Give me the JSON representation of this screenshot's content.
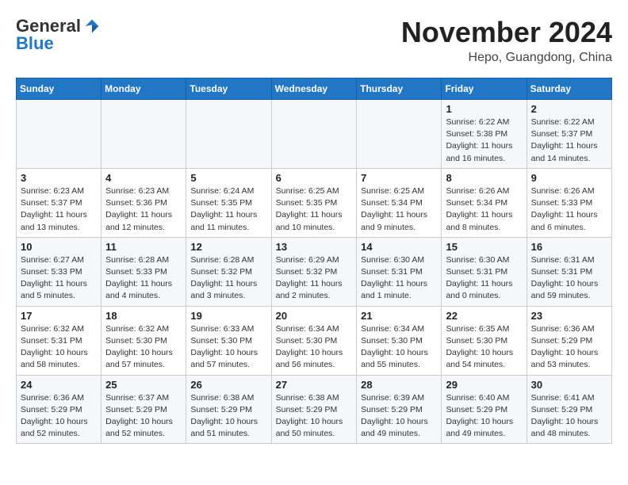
{
  "header": {
    "logo_general": "General",
    "logo_blue": "Blue",
    "month_title": "November 2024",
    "location": "Hepo, Guangdong, China"
  },
  "days_of_week": [
    "Sunday",
    "Monday",
    "Tuesday",
    "Wednesday",
    "Thursday",
    "Friday",
    "Saturday"
  ],
  "weeks": [
    [
      {
        "day": "",
        "info": ""
      },
      {
        "day": "",
        "info": ""
      },
      {
        "day": "",
        "info": ""
      },
      {
        "day": "",
        "info": ""
      },
      {
        "day": "",
        "info": ""
      },
      {
        "day": "1",
        "info": "Sunrise: 6:22 AM\nSunset: 5:38 PM\nDaylight: 11 hours and 16 minutes."
      },
      {
        "day": "2",
        "info": "Sunrise: 6:22 AM\nSunset: 5:37 PM\nDaylight: 11 hours and 14 minutes."
      }
    ],
    [
      {
        "day": "3",
        "info": "Sunrise: 6:23 AM\nSunset: 5:37 PM\nDaylight: 11 hours and 13 minutes."
      },
      {
        "day": "4",
        "info": "Sunrise: 6:23 AM\nSunset: 5:36 PM\nDaylight: 11 hours and 12 minutes."
      },
      {
        "day": "5",
        "info": "Sunrise: 6:24 AM\nSunset: 5:35 PM\nDaylight: 11 hours and 11 minutes."
      },
      {
        "day": "6",
        "info": "Sunrise: 6:25 AM\nSunset: 5:35 PM\nDaylight: 11 hours and 10 minutes."
      },
      {
        "day": "7",
        "info": "Sunrise: 6:25 AM\nSunset: 5:34 PM\nDaylight: 11 hours and 9 minutes."
      },
      {
        "day": "8",
        "info": "Sunrise: 6:26 AM\nSunset: 5:34 PM\nDaylight: 11 hours and 8 minutes."
      },
      {
        "day": "9",
        "info": "Sunrise: 6:26 AM\nSunset: 5:33 PM\nDaylight: 11 hours and 6 minutes."
      }
    ],
    [
      {
        "day": "10",
        "info": "Sunrise: 6:27 AM\nSunset: 5:33 PM\nDaylight: 11 hours and 5 minutes."
      },
      {
        "day": "11",
        "info": "Sunrise: 6:28 AM\nSunset: 5:33 PM\nDaylight: 11 hours and 4 minutes."
      },
      {
        "day": "12",
        "info": "Sunrise: 6:28 AM\nSunset: 5:32 PM\nDaylight: 11 hours and 3 minutes."
      },
      {
        "day": "13",
        "info": "Sunrise: 6:29 AM\nSunset: 5:32 PM\nDaylight: 11 hours and 2 minutes."
      },
      {
        "day": "14",
        "info": "Sunrise: 6:30 AM\nSunset: 5:31 PM\nDaylight: 11 hours and 1 minute."
      },
      {
        "day": "15",
        "info": "Sunrise: 6:30 AM\nSunset: 5:31 PM\nDaylight: 11 hours and 0 minutes."
      },
      {
        "day": "16",
        "info": "Sunrise: 6:31 AM\nSunset: 5:31 PM\nDaylight: 10 hours and 59 minutes."
      }
    ],
    [
      {
        "day": "17",
        "info": "Sunrise: 6:32 AM\nSunset: 5:31 PM\nDaylight: 10 hours and 58 minutes."
      },
      {
        "day": "18",
        "info": "Sunrise: 6:32 AM\nSunset: 5:30 PM\nDaylight: 10 hours and 57 minutes."
      },
      {
        "day": "19",
        "info": "Sunrise: 6:33 AM\nSunset: 5:30 PM\nDaylight: 10 hours and 57 minutes."
      },
      {
        "day": "20",
        "info": "Sunrise: 6:34 AM\nSunset: 5:30 PM\nDaylight: 10 hours and 56 minutes."
      },
      {
        "day": "21",
        "info": "Sunrise: 6:34 AM\nSunset: 5:30 PM\nDaylight: 10 hours and 55 minutes."
      },
      {
        "day": "22",
        "info": "Sunrise: 6:35 AM\nSunset: 5:30 PM\nDaylight: 10 hours and 54 minutes."
      },
      {
        "day": "23",
        "info": "Sunrise: 6:36 AM\nSunset: 5:29 PM\nDaylight: 10 hours and 53 minutes."
      }
    ],
    [
      {
        "day": "24",
        "info": "Sunrise: 6:36 AM\nSunset: 5:29 PM\nDaylight: 10 hours and 52 minutes."
      },
      {
        "day": "25",
        "info": "Sunrise: 6:37 AM\nSunset: 5:29 PM\nDaylight: 10 hours and 52 minutes."
      },
      {
        "day": "26",
        "info": "Sunrise: 6:38 AM\nSunset: 5:29 PM\nDaylight: 10 hours and 51 minutes."
      },
      {
        "day": "27",
        "info": "Sunrise: 6:38 AM\nSunset: 5:29 PM\nDaylight: 10 hours and 50 minutes."
      },
      {
        "day": "28",
        "info": "Sunrise: 6:39 AM\nSunset: 5:29 PM\nDaylight: 10 hours and 49 minutes."
      },
      {
        "day": "29",
        "info": "Sunrise: 6:40 AM\nSunset: 5:29 PM\nDaylight: 10 hours and 49 minutes."
      },
      {
        "day": "30",
        "info": "Sunrise: 6:41 AM\nSunset: 5:29 PM\nDaylight: 10 hours and 48 minutes."
      }
    ]
  ]
}
